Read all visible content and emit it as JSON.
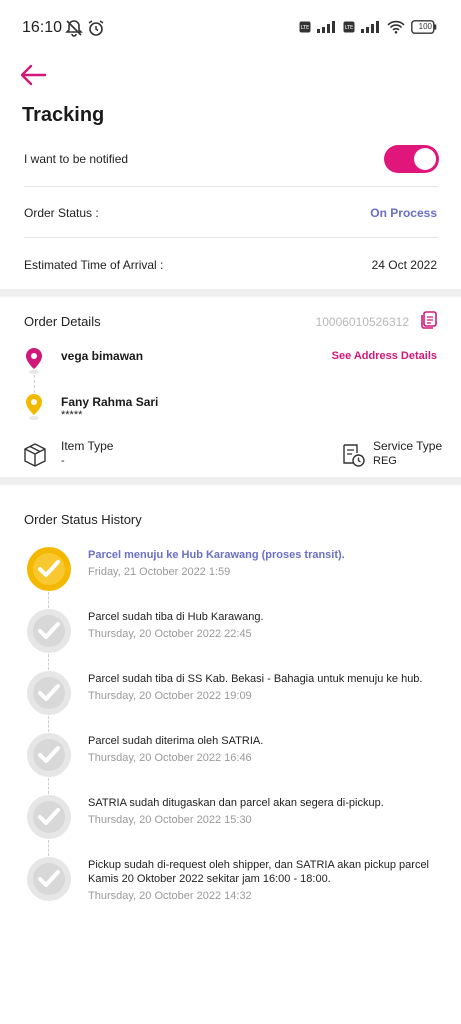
{
  "status_bar": {
    "time": "16:10",
    "battery": "100"
  },
  "page": {
    "title": "Tracking"
  },
  "notify": {
    "label": "I want to be notified",
    "enabled": true
  },
  "order_status": {
    "label": "Order Status :",
    "value": "On Process"
  },
  "eta": {
    "label": "Estimated Time of Arrival :",
    "value": "24 Oct 2022"
  },
  "order_details": {
    "title": "Order Details",
    "order_number": "10006010526312",
    "sender": {
      "name": "vega bimawan",
      "link": "See Address Details"
    },
    "receiver": {
      "name": "Fany Rahma Sari",
      "phone": "*****"
    },
    "item_type": {
      "label": "Item Type",
      "value": "-"
    },
    "service_type": {
      "label": "Service Type",
      "value": "REG"
    }
  },
  "history": {
    "title": "Order Status History",
    "items": [
      {
        "text": "Parcel menuju ke Hub Karawang (proses transit).",
        "date": "Friday, 21 October 2022 1:59",
        "active": true
      },
      {
        "text": "Parcel sudah tiba di Hub Karawang.",
        "date": "Thursday, 20 October 2022 22:45",
        "active": false
      },
      {
        "text": "Parcel sudah tiba di SS Kab. Bekasi - Bahagia untuk menuju ke hub.",
        "date": "Thursday, 20 October 2022 19:09",
        "active": false
      },
      {
        "text": "Parcel sudah diterima oleh SATRIA.",
        "date": "Thursday, 20 October 2022 16:46",
        "active": false
      },
      {
        "text": "SATRIA sudah ditugaskan dan parcel akan segera di-pickup.",
        "date": "Thursday, 20 October 2022 15:30",
        "active": false
      },
      {
        "text": "Pickup sudah di-request oleh shipper, dan SATRIA akan pickup parcel Kamis 20 Oktober 2022 sekitar jam 16:00 - 18:00.",
        "date": "Thursday, 20 October 2022 14:32",
        "active": false
      }
    ]
  },
  "colors": {
    "accent": "#e0167a",
    "status": "#6b6fc7",
    "active_history": "#f5b800",
    "inactive_history": "#e6e6e6"
  }
}
